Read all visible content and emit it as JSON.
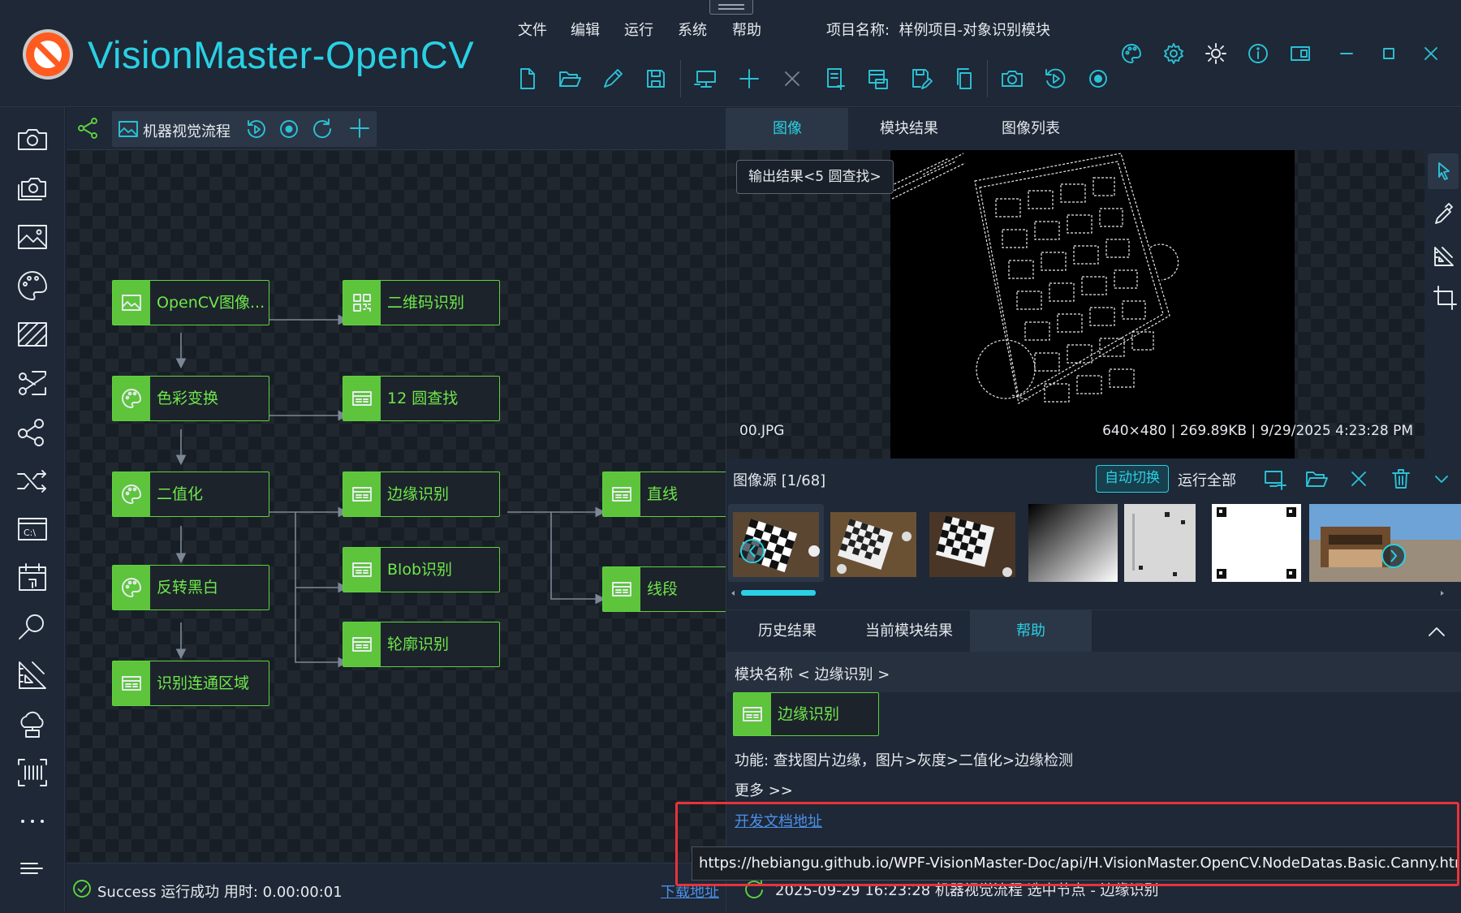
{
  "header": {
    "app_title": "VisionMaster-OpenCV",
    "menu": [
      "文件",
      "编辑",
      "运行",
      "系统",
      "帮助"
    ],
    "project_label": "项目名称:",
    "project_name": "样例项目-对象识别模块"
  },
  "flow": {
    "tab_label": "机器视觉流程",
    "nodes": {
      "n1": "OpenCV图像...",
      "n2": "色彩变换",
      "n3": "二值化",
      "n4": "反转黑白",
      "n5": "识别连通区域",
      "n6": "二维码识别",
      "n7": "12 圆查找",
      "n8": "边缘识别",
      "n9": "Blob识别",
      "n10": "轮廓识别",
      "n11": "直线",
      "n12": "线段"
    }
  },
  "status": {
    "text": "Success 运行成功 用时: 0.00:00:01",
    "link": "下载地址"
  },
  "image_panel": {
    "tabs": [
      "图像",
      "模块结果",
      "图像列表"
    ],
    "output_badge": "输出结果<5 圆查找>",
    "file_name": "00.JPG",
    "file_info": "640×480 | 269.89KB | 9/29/2025 4:23:28 PM"
  },
  "source": {
    "label": "图像源 [1/68]",
    "auto_switch": "自动切换",
    "run_all": "运行全部"
  },
  "bottom_tabs": [
    "历史结果",
    "当前模块结果",
    "帮助"
  ],
  "help": {
    "module_name": "模块名称 < 边缘识别 >",
    "node_label": "边缘识别",
    "function": "功能: 查找图片边缘，图片>灰度>二值化>边缘检测",
    "more": "更多 >>",
    "doc_link": "开发文档地址",
    "log": "2025-09-29 16:23:28 机器视觉流程 选中节点 - 边缘识别"
  },
  "tooltip": "https://hebiangu.github.io/WPF-VisionMaster-Doc/api/H.VisionMaster.OpenCV.NodeDatas.Basic.Canny.html",
  "colors": {
    "accent": "#2ad0e4",
    "node_green": "#5dc43c",
    "node_text": "#6ee84a",
    "link": "#4c8fe8",
    "highlight": "#e8333a"
  }
}
